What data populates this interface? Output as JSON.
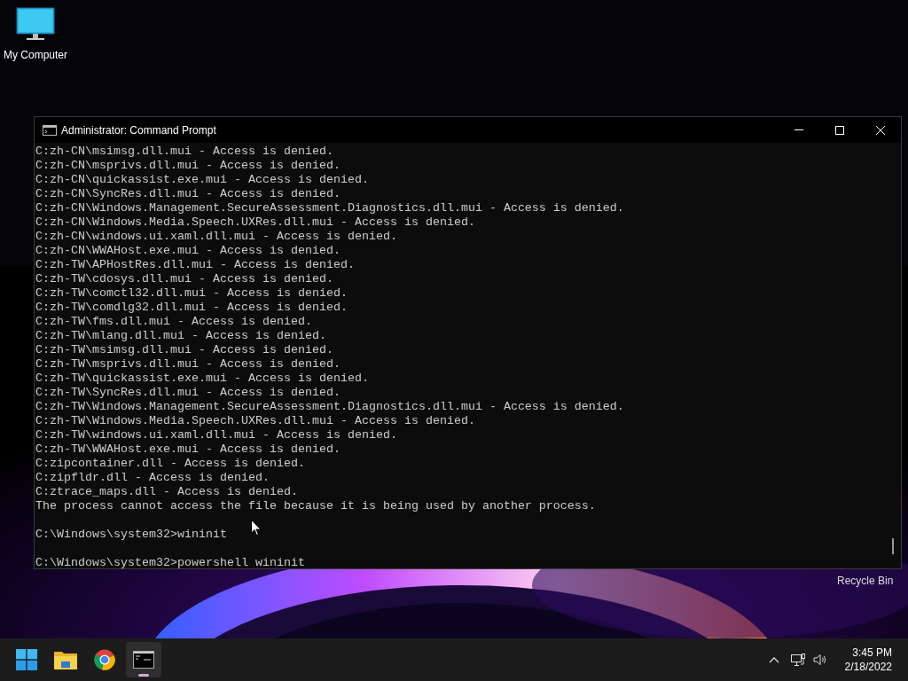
{
  "desktop_icons": [
    {
      "label": "My Computer",
      "kind": "computer"
    }
  ],
  "window": {
    "title": "Administrator: Command Prompt",
    "output": [
      [
        "C:zh-CN\\msimsg.dll.mui - Access is denied.",
        "C:zh-CN\\msprivs.dll.mui - Access is denied.",
        "C:zh-CN\\quickassist.exe.mui - Access is denied.",
        "C:zh-CN\\SyncRes.dll.mui - Access is denied.",
        "C:zh-CN\\Windows.Management.SecureAssessment.Diagnostics.dll.mui - Access is denied.",
        "C:zh-CN\\Windows.Media.Speech.UXRes.dll.mui - Access is denied.",
        "C:zh-CN\\windows.ui.xaml.dll.mui - Access is denied.",
        "C:zh-CN\\WWAHost.exe.mui - Access is denied.",
        "C:zh-TW\\APHostRes.dll.mui - Access is denied.",
        "C:zh-TW\\cdosys.dll.mui - Access is denied.",
        "C:zh-TW\\comctl32.dll.mui - Access is denied.",
        "C:zh-TW\\comdlg32.dll.mui - Access is denied.",
        "C:zh-TW\\fms.dll.mui - Access is denied.",
        "C:zh-TW\\mlang.dll.mui - Access is denied.",
        "C:zh-TW\\msimsg.dll.mui - Access is denied.",
        "C:zh-TW\\msprivs.dll.mui - Access is denied.",
        "C:zh-TW\\quickassist.exe.mui - Access is denied.",
        "C:zh-TW\\SyncRes.dll.mui - Access is denied.",
        "C:zh-TW\\Windows.Management.SecureAssessment.Diagnostics.dll.mui - Access is denied.",
        "C:zh-TW\\Windows.Media.Speech.UXRes.dll.mui - Access is denied.",
        "C:zh-TW\\windows.ui.xaml.dll.mui - Access is denied.",
        "C:zh-TW\\WWAHost.exe.mui - Access is denied.",
        "C:zipcontainer.dll - Access is denied.",
        "C:zipfldr.dll - Access is denied.",
        "C:ztrace_maps.dll - Access is denied.",
        "The process cannot access the file because it is being used by another process."
      ],
      [
        "C:\\Windows\\system32>wininit"
      ],
      [
        "C:\\Windows\\system32>powershell wininit"
      ]
    ]
  },
  "recycle_bin": {
    "label": "Recycle Bin"
  },
  "taskbar": {
    "apps": [
      {
        "kind": "start",
        "selected": false
      },
      {
        "kind": "folder",
        "selected": false
      },
      {
        "kind": "browser",
        "selected": false
      },
      {
        "kind": "terminal",
        "selected": true
      }
    ],
    "clock": {
      "time": "3:45 PM",
      "date": "2/18/2022"
    }
  }
}
